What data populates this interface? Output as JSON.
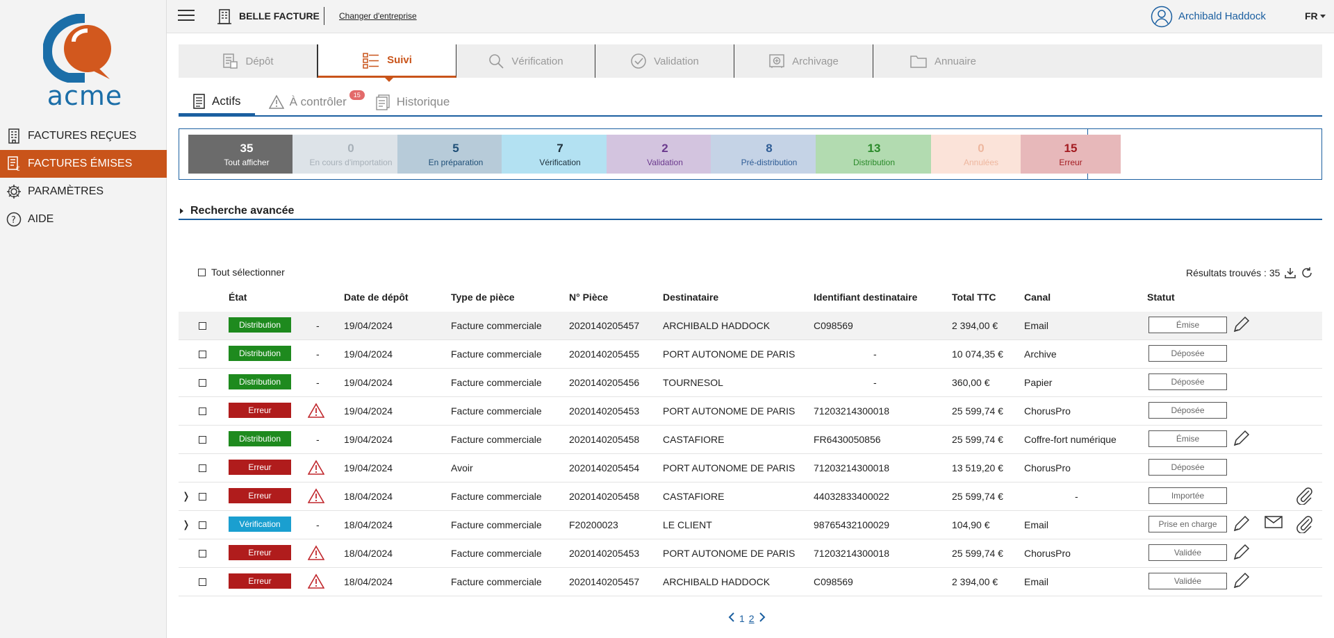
{
  "brand": {
    "logo_text": "acme",
    "accent": "#c9541a",
    "primary": "#1b5fa0"
  },
  "sidebar": {
    "items": [
      {
        "label": "FACTURES REÇUES",
        "icon": "building-icon",
        "active": false
      },
      {
        "label": "FACTURES ÉMISES",
        "icon": "invoice-icon",
        "active": true
      },
      {
        "label": "PARAMÈTRES",
        "icon": "gear-icon",
        "active": false
      },
      {
        "label": "AIDE",
        "icon": "help-icon",
        "active": false
      }
    ]
  },
  "topbar": {
    "company": "BELLE FACTURE",
    "change_company": "Changer d'entreprise",
    "user": "Archibald Haddock",
    "lang": "FR"
  },
  "main_tabs": [
    {
      "label": "Dépôt",
      "icon": "upload-doc-icon"
    },
    {
      "label": "Suivi",
      "icon": "list-icon",
      "active": true
    },
    {
      "label": "Vérification",
      "icon": "magnifier-icon"
    },
    {
      "label": "Validation",
      "icon": "check-circle-icon"
    },
    {
      "label": "Archivage",
      "icon": "safe-icon"
    },
    {
      "label": "Annuaire",
      "icon": "folder-icon"
    }
  ],
  "sub_tabs": [
    {
      "label": "Actifs",
      "icon": "doc-icon",
      "active": true
    },
    {
      "label": "À contrôler",
      "icon": "warning-icon",
      "badge": "15"
    },
    {
      "label": "Historique",
      "icon": "history-icon"
    }
  ],
  "counters": [
    {
      "n": "35",
      "label": "Tout afficher",
      "bg": "#6b6b6b",
      "fg": "#ffffff"
    },
    {
      "n": "0",
      "label": "En cours d'importation",
      "bg": "#dde3e8",
      "fg": "#a7b0b8"
    },
    {
      "n": "5",
      "label": "En préparation",
      "bg": "#b7cbd9",
      "fg": "#1f4f77"
    },
    {
      "n": "7",
      "label": "Vérification",
      "bg": "#b3e1f2",
      "fg": "#1d2f3a"
    },
    {
      "n": "2",
      "label": "Validation",
      "bg": "#d3c4df",
      "fg": "#6b3a8e"
    },
    {
      "n": "8",
      "label": "Pré-distribution",
      "bg": "#c5d3e6",
      "fg": "#2f5d96"
    },
    {
      "n": "13",
      "label": "Distribution",
      "bg": "#b2dbb0",
      "fg": "#2a8a2a"
    },
    {
      "n": "0",
      "label": "Annulées",
      "bg": "#fbe3d9",
      "fg": "#eeb79f"
    },
    {
      "n": "15",
      "label": "Erreur",
      "bg": "#e7b8ba",
      "fg": "#a31b20"
    }
  ],
  "advanced_search": "Recherche avancée",
  "table": {
    "select_all": "Tout sélectionner",
    "results": "Résultats trouvés : 35",
    "headers": [
      "État",
      "Date de dépôt",
      "Type de pièce",
      "N° Pièce",
      "Destinataire",
      "Identifiant destinataire",
      "Total TTC",
      "Canal",
      "Statut"
    ],
    "rows": [
      {
        "expand": "",
        "etat": "Distribution",
        "etat_color": "#1e8a1e",
        "warn": false,
        "dash": "-",
        "date": "19/04/2024",
        "type": "Facture commerciale",
        "num": "2020140205457",
        "dest": "ARCHIBALD HADDOCK",
        "ident": "C098569",
        "total": "2 394,00 €",
        "canal": "Email",
        "statut": "Émise",
        "actions": [
          "pencil-icon"
        ],
        "hl": true
      },
      {
        "expand": "",
        "etat": "Distribution",
        "etat_color": "#1e8a1e",
        "warn": false,
        "dash": "-",
        "date": "19/04/2024",
        "type": "Facture commerciale",
        "num": "2020140205455",
        "dest": "PORT AUTONOME DE PARIS",
        "ident": "-",
        "total": "10 074,35 €",
        "canal": "Archive",
        "statut": "Déposée",
        "actions": []
      },
      {
        "expand": "",
        "etat": "Distribution",
        "etat_color": "#1e8a1e",
        "warn": false,
        "dash": "-",
        "date": "19/04/2024",
        "type": "Facture commerciale",
        "num": "2020140205456",
        "dest": "TOURNESOL",
        "ident": "-",
        "total": "360,00 €",
        "canal": "Papier",
        "statut": "Déposée",
        "actions": []
      },
      {
        "expand": "",
        "etat": "Erreur",
        "etat_color": "#b01c1c",
        "warn": true,
        "dash": "",
        "date": "19/04/2024",
        "type": "Facture commerciale",
        "num": "2020140205453",
        "dest": "PORT AUTONOME DE PARIS",
        "ident": "71203214300018",
        "total": "25 599,74 €",
        "canal": "ChorusPro",
        "statut": "Déposée",
        "actions": []
      },
      {
        "expand": "",
        "etat": "Distribution",
        "etat_color": "#1e8a1e",
        "warn": false,
        "dash": "-",
        "date": "19/04/2024",
        "type": "Facture commerciale",
        "num": "2020140205458",
        "dest": "CASTAFIORE",
        "ident": "FR6430050856",
        "total": "25 599,74 €",
        "canal": "Coffre-fort numérique",
        "statut": "Émise",
        "actions": [
          "pencil-icon"
        ]
      },
      {
        "expand": "",
        "etat": "Erreur",
        "etat_color": "#b01c1c",
        "warn": true,
        "dash": "",
        "date": "19/04/2024",
        "type": "Avoir",
        "num": "2020140205454",
        "dest": "PORT AUTONOME DE PARIS",
        "ident": "71203214300018",
        "total": "13 519,20 €",
        "canal": "ChorusPro",
        "statut": "Déposée",
        "actions": []
      },
      {
        "expand": "❭",
        "etat": "Erreur",
        "etat_color": "#b01c1c",
        "warn": true,
        "dash": "",
        "date": "18/04/2024",
        "type": "Facture commerciale",
        "num": "2020140205458",
        "dest": "CASTAFIORE",
        "ident": "44032833400022",
        "total": "25 599,74 €",
        "canal": "-",
        "statut": "Importée",
        "actions": [
          "paperclip-icon"
        ]
      },
      {
        "expand": "❭",
        "etat": "Vérification",
        "etat_color": "#1a9fd0",
        "warn": false,
        "dash": "-",
        "date": "18/04/2024",
        "type": "Facture commerciale",
        "num": "F20200023",
        "dest": "LE CLIENT",
        "ident": "98765432100029",
        "total": "104,90 €",
        "canal": "Email",
        "statut": "Prise en charge",
        "actions": [
          "pencil-icon",
          "envelope-icon",
          "paperclip-icon"
        ]
      },
      {
        "expand": "",
        "etat": "Erreur",
        "etat_color": "#b01c1c",
        "warn": true,
        "dash": "",
        "date": "18/04/2024",
        "type": "Facture commerciale",
        "num": "2020140205453",
        "dest": "PORT AUTONOME DE PARIS",
        "ident": "71203214300018",
        "total": "25 599,74 €",
        "canal": "ChorusPro",
        "statut": "Validée",
        "actions": [
          "pencil-icon"
        ]
      },
      {
        "expand": "",
        "etat": "Erreur",
        "etat_color": "#b01c1c",
        "warn": true,
        "dash": "",
        "date": "18/04/2024",
        "type": "Facture commerciale",
        "num": "2020140205457",
        "dest": "ARCHIBALD HADDOCK",
        "ident": "C098569",
        "total": "2 394,00 €",
        "canal": "Email",
        "statut": "Validée",
        "actions": [
          "pencil-icon"
        ]
      }
    ]
  },
  "pager": {
    "pages": [
      "1",
      "2"
    ],
    "current": "1"
  }
}
